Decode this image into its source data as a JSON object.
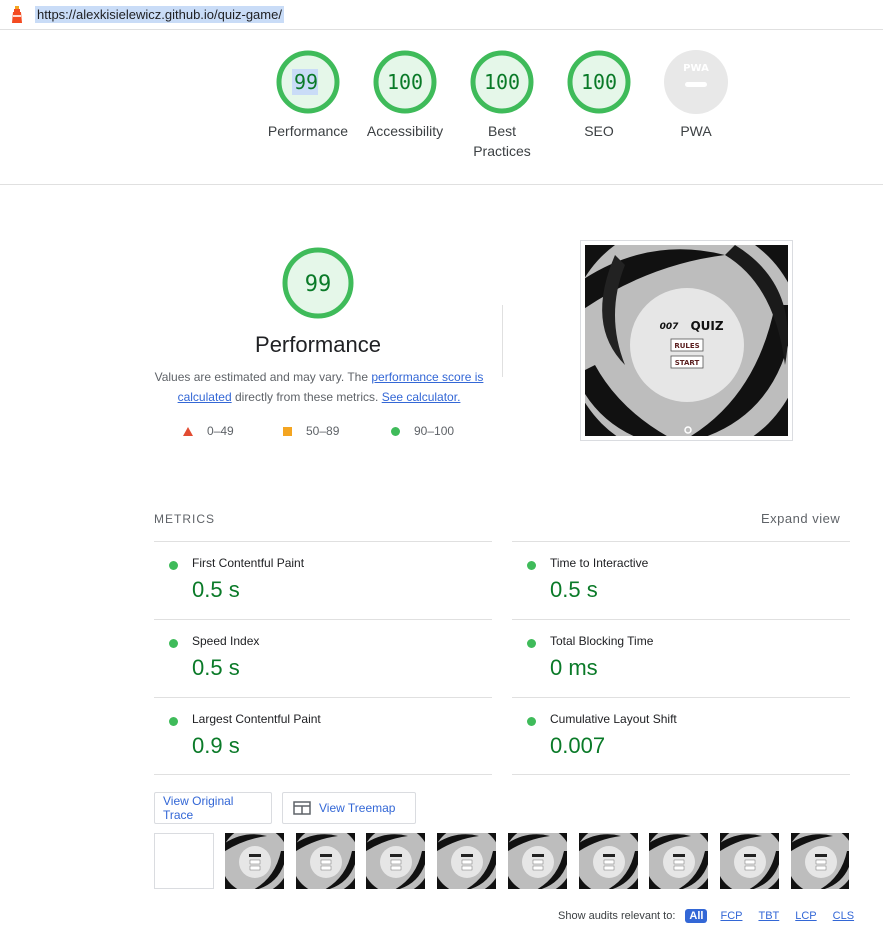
{
  "topbar": {
    "url": "https://alexkisielewicz.github.io/quiz-game/"
  },
  "gauges": [
    {
      "label": "Performance",
      "score": "99"
    },
    {
      "label": "Accessibility",
      "score": "100"
    },
    {
      "label": "Best Practices",
      "score": "100"
    },
    {
      "label": "SEO",
      "score": "100"
    },
    {
      "label": "PWA",
      "badge": "PWA"
    }
  ],
  "performance": {
    "score": "99",
    "title": "Performance",
    "desc_part1": "Values are estimated and may vary. The ",
    "link_score": "performance score is calculated",
    "desc_part2": " directly from these metrics. ",
    "link_calc": "See calculator.",
    "legend": [
      {
        "range": "0–49"
      },
      {
        "range": "50–89"
      },
      {
        "range": "90–100"
      }
    ]
  },
  "final_screenshot": {
    "quiz_brand": "007",
    "quiz_title": "QUIZ",
    "rules_label": "RULES",
    "start_label": "START"
  },
  "metrics": {
    "heading": "METRICS",
    "expand_label": "Expand view",
    "items": [
      {
        "name": "First Contentful Paint",
        "value": "0.5 s"
      },
      {
        "name": "Time to Interactive",
        "value": "0.5 s"
      },
      {
        "name": "Speed Index",
        "value": "0.5 s"
      },
      {
        "name": "Total Blocking Time",
        "value": "0 ms"
      },
      {
        "name": "Largest Contentful Paint",
        "value": "0.9 s"
      },
      {
        "name": "Cumulative Layout Shift",
        "value": "0.007"
      }
    ]
  },
  "buttons": {
    "trace": "View Original Trace",
    "treemap": "View Treemap"
  },
  "filters": {
    "label": "Show audits relevant to:",
    "options": [
      "All",
      "FCP",
      "TBT",
      "LCP",
      "CLS"
    ]
  },
  "colors": {
    "pass": "#0a7a28",
    "pass_ring": "#3fbb5a",
    "average": "#f4a521",
    "fail": "#e24c32",
    "link": "#3367d6"
  }
}
